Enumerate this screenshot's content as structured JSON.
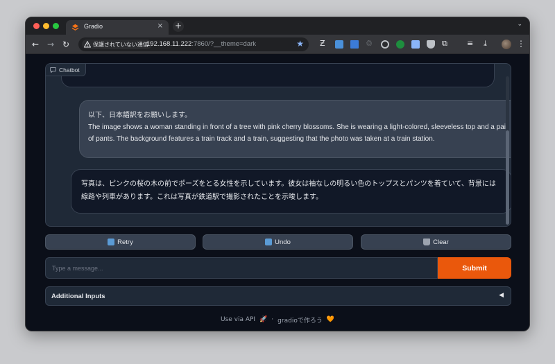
{
  "browser": {
    "tab_title": "Gradio",
    "tab_close": "×",
    "new_tab": "+",
    "tab_menu": "⌄",
    "security_label": "保護されていない通信",
    "url_host": "192.168.11.222",
    "url_rest": ":7860/?__theme=dark",
    "back": "←",
    "forward": "→",
    "reload": "↻",
    "bookmark": "★",
    "menu": "⋮"
  },
  "chatbot": {
    "label": "Chatbot",
    "messages": [
      {
        "role": "user",
        "line1": "以下、日本語訳をお願いします。",
        "line2": "The image shows a woman standing in front of a tree with pink cherry blossoms. She is wearing a light-colored, sleeveless top and a pair of pants. The background features a train track and a train, suggesting that the photo was taken at a train station."
      },
      {
        "role": "bot",
        "text": "写真は、ピンクの桜の木の前でポーズをとる女性を示しています。彼女は袖なしの明るい色のトップスとパンツを着ていて、背景には線路や列車があります。これは写真が鉄道駅で撮影されたことを示唆します。"
      }
    ]
  },
  "actions": {
    "retry": "Retry",
    "undo": "Undo",
    "clear": "Clear"
  },
  "input": {
    "placeholder": "Type a message...",
    "value": "",
    "submit": "Submit"
  },
  "accordion": {
    "label": "Additional Inputs",
    "arrow": "◀"
  },
  "footer": {
    "api": "Use via API",
    "api_emoji": "🚀",
    "sep": "·",
    "built": "gradioで作ろう",
    "built_emoji": "🧡"
  },
  "colors": {
    "accent": "#ea580c",
    "background": "#0b0f19",
    "panel": "#1f2937"
  }
}
